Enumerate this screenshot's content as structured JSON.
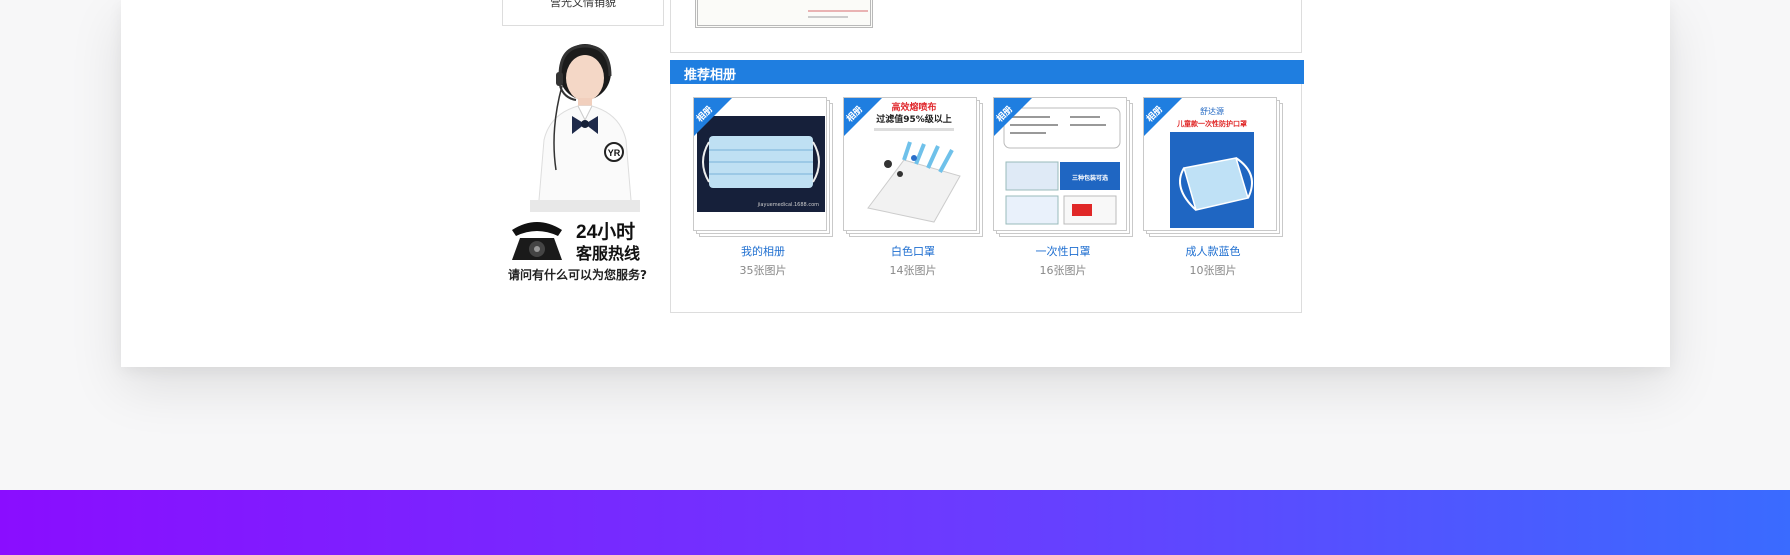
{
  "left_top_box": {
    "text": "营光文情销貌"
  },
  "service": {
    "hotline_big": "24小时",
    "hotline_sub": "客服热线",
    "ask": "请问有什么可以为您服务?",
    "badge": "YR"
  },
  "album_section": {
    "title": "推荐相册",
    "ribbon_label": "相册",
    "albums": [
      {
        "name": "我的相册",
        "count": "35张图片"
      },
      {
        "name": "白色口罩",
        "count": "14张图片"
      },
      {
        "name": "一次性口罩",
        "count": "16张图片"
      },
      {
        "name": "成人款蓝色",
        "count": "10张图片"
      }
    ]
  },
  "thumbs": {
    "mask_watermark": "jiayuemedical.1688.com",
    "filter_title": "高效熔喷布",
    "filter_sub": "过滤值95%级以上",
    "pack_badge": "三种包装可选",
    "kids_brand": "舒达源",
    "kids_title": "儿童款一次性防护口罩"
  },
  "colors": {
    "accent": "#1f7ee0",
    "link": "#1f6fd0",
    "footer_gradient_start": "#8a0dff",
    "footer_gradient_end": "#3a6bff"
  }
}
